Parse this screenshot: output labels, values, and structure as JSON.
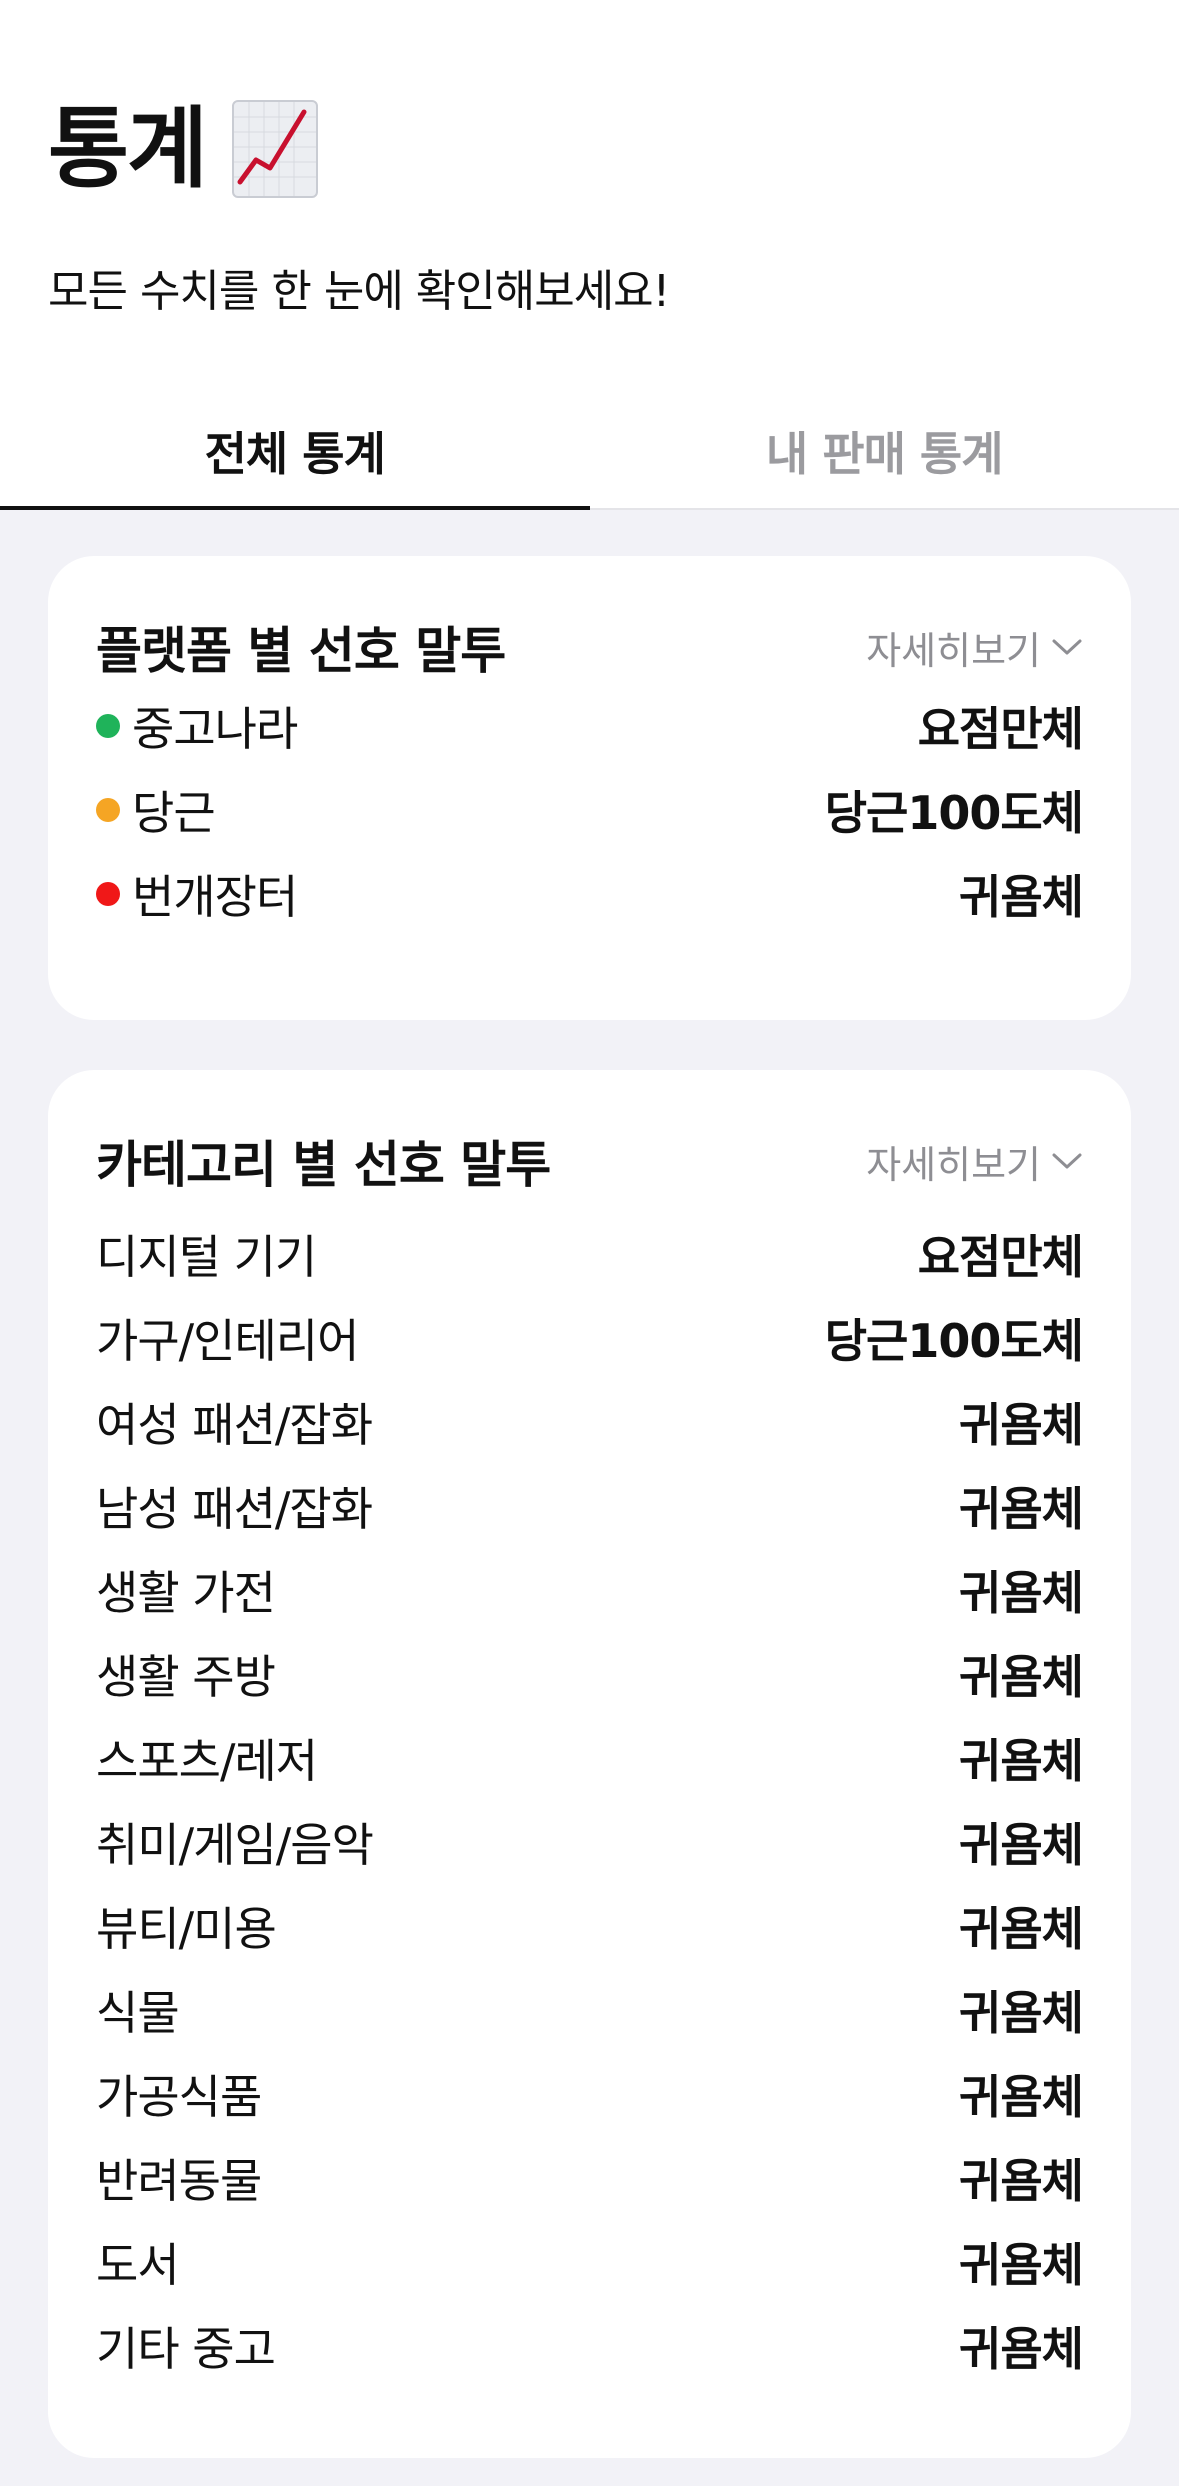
{
  "header": {
    "title": "통계",
    "title_icon": "chart-increasing-icon",
    "subtitle": "모든 수치를 한 눈에 확인해보세요!"
  },
  "tabs": [
    {
      "label": "전체 통계",
      "active": true
    },
    {
      "label": "내 판매 통계",
      "active": false
    }
  ],
  "platform_card": {
    "title": "플랫폼 별 선호 말투",
    "more_label": "자세히보기",
    "items": [
      {
        "label": "중고나라",
        "value": "요점만체",
        "color": "#1fb35a"
      },
      {
        "label": "당근",
        "value": "당근100도체",
        "color": "#f5a524"
      },
      {
        "label": "번개장터",
        "value": "귀욤체",
        "color": "#f01818"
      }
    ]
  },
  "category_card": {
    "title": "카테고리 별 선호 말투",
    "more_label": "자세히보기",
    "items": [
      {
        "label": "디지털 기기",
        "value": "요점만체"
      },
      {
        "label": "가구/인테리어",
        "value": "당근100도체"
      },
      {
        "label": "여성 패션/잡화",
        "value": "귀욤체"
      },
      {
        "label": "남성 패션/잡화",
        "value": "귀욤체"
      },
      {
        "label": "생활 가전",
        "value": "귀욤체"
      },
      {
        "label": "생활 주방",
        "value": "귀욤체"
      },
      {
        "label": "스포츠/레저",
        "value": "귀욤체"
      },
      {
        "label": "취미/게임/음악",
        "value": "귀욤체"
      },
      {
        "label": "뷰티/미용",
        "value": "귀욤체"
      },
      {
        "label": "식물",
        "value": "귀욤체"
      },
      {
        "label": "가공식품",
        "value": "귀욤체"
      },
      {
        "label": "반려동물",
        "value": "귀욤체"
      },
      {
        "label": "도서",
        "value": "귀욤체"
      },
      {
        "label": "기타 중고",
        "value": "귀욤체"
      }
    ]
  }
}
